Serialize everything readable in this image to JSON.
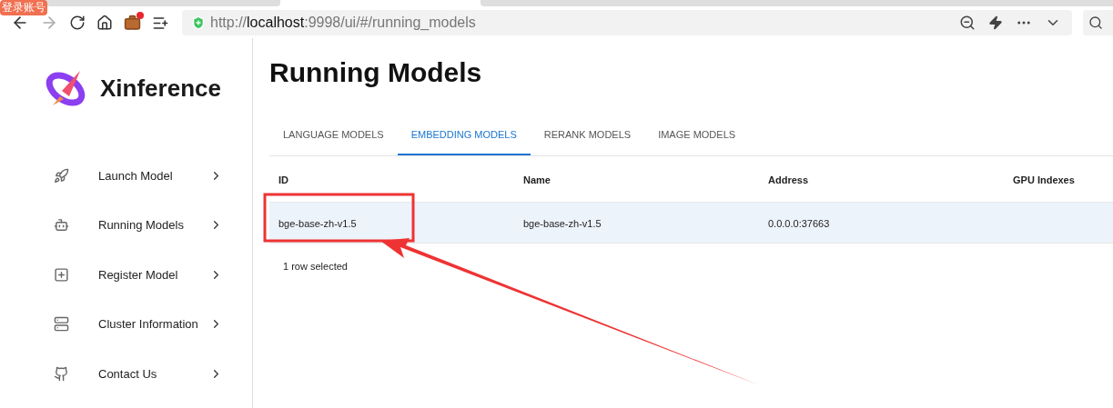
{
  "browser": {
    "badge": "登录账号",
    "back": {
      "disabled": false
    },
    "forward": {
      "disabled": true
    },
    "extension_notification": true,
    "address_bar": {
      "scheme": "http://",
      "host": "localhost",
      "path": ":9998/ui/#/running_models"
    }
  },
  "sidebar": {
    "brand": "Xinference",
    "items": [
      {
        "kind": "rocket",
        "label": "Launch Model"
      },
      {
        "kind": "robot",
        "label": "Running Models"
      },
      {
        "kind": "plus",
        "label": "Register Model"
      },
      {
        "kind": "server",
        "label": "Cluster Information"
      },
      {
        "kind": "github",
        "label": "Contact Us"
      }
    ]
  },
  "page": {
    "title": "Running Models",
    "tabs": [
      {
        "label": "LANGUAGE MODELS",
        "selected": false
      },
      {
        "label": "EMBEDDING MODELS",
        "selected": true
      },
      {
        "label": "RERANK MODELS",
        "selected": false
      },
      {
        "label": "IMAGE MODELS",
        "selected": false
      }
    ],
    "table": {
      "columns": [
        "ID",
        "Name",
        "Address",
        "GPU Indexes"
      ],
      "rows": [
        {
          "cells": [
            "bge-base-zh-v1.5",
            "bge-base-zh-v1.5",
            "0.0.0.0:37663"
          ],
          "selected": true
        }
      ],
      "footer": "1 row selected"
    }
  }
}
